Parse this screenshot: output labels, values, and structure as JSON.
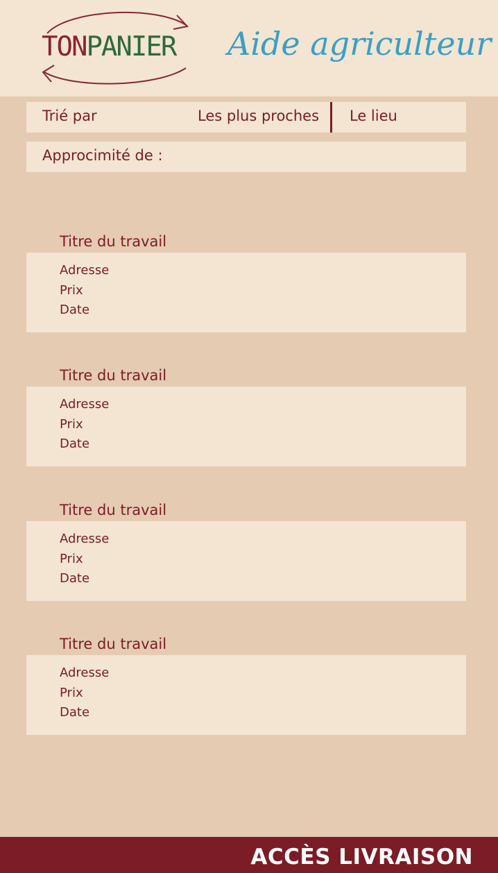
{
  "header": {
    "logo_ton": "TON",
    "logo_panier": "PANIER",
    "subtitle": "Aide agriculteur"
  },
  "sort_bar": {
    "label": "Trié par",
    "option_closest": "Les plus proches",
    "option_place": "Le lieu"
  },
  "proximity": {
    "label": "Approcimité de :"
  },
  "jobs": [
    {
      "title": "Titre du travail",
      "address": "Adresse",
      "price": "Prix",
      "date": "Date"
    },
    {
      "title": "Titre du travail",
      "address": "Adresse",
      "price": "Prix",
      "date": "Date"
    },
    {
      "title": "Titre du travail",
      "address": "Adresse",
      "price": "Prix",
      "date": "Date"
    },
    {
      "title": "Titre du travail",
      "address": "Adresse",
      "price": "Prix",
      "date": "Date"
    }
  ],
  "footer": {
    "button_label": "ACCÈS LIVRAISON"
  },
  "colors": {
    "background": "#e4cbb1",
    "panel": "#f3e5d2",
    "accent": "#7c1c26",
    "logo_green": "#2e6a3a",
    "subtitle_blue": "#3a9fc6"
  }
}
